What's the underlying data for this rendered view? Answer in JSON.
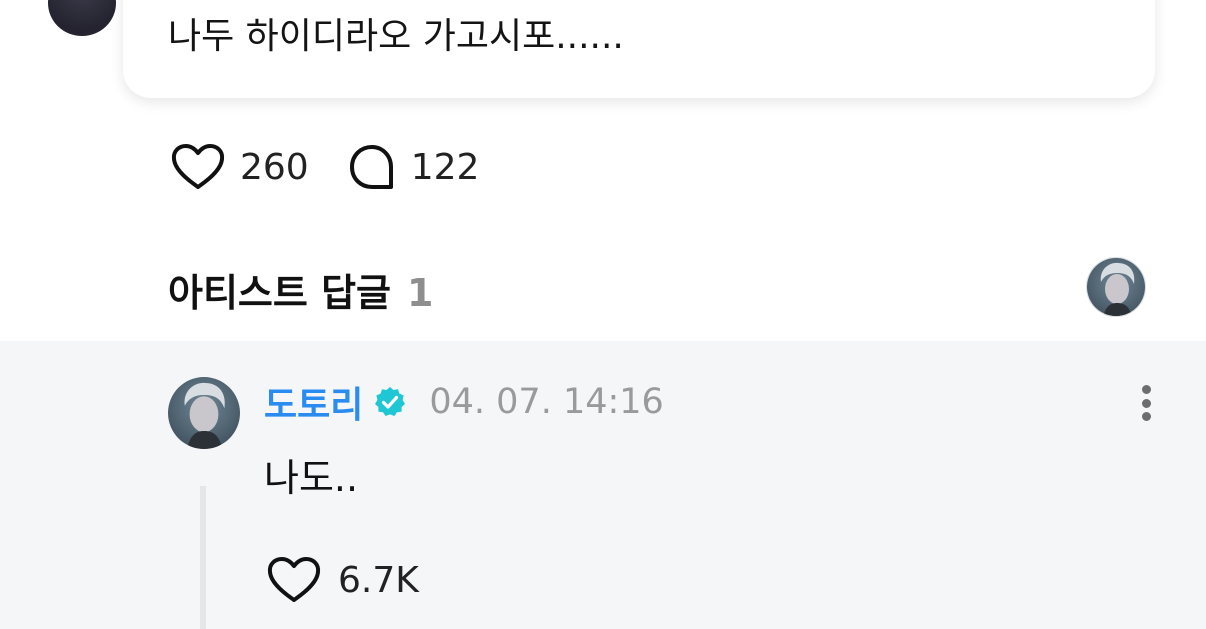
{
  "post": {
    "text": "나두 하이디라오 가고시포......",
    "likes": "260",
    "comments": "122"
  },
  "artist_replies": {
    "title": "아티스트 답글",
    "count": "1"
  },
  "reply": {
    "author": "도토리",
    "timestamp": "04. 07. 14:16",
    "text": "나도..",
    "likes": "6.7K"
  },
  "icons": {
    "like": "heart-outline-icon",
    "comment": "speech-bubble-icon",
    "verified": "verified-badge-icon",
    "more": "vertical-ellipsis-icon"
  },
  "colors": {
    "author_name": "#2a8cf0",
    "verified_badge": "#1fc6d4",
    "reply_background": "#f5f6f8",
    "muted_text": "#9a9a9a"
  }
}
